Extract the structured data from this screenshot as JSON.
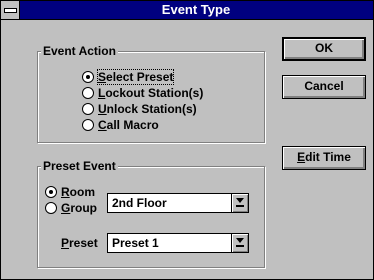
{
  "window": {
    "title": "Event Type"
  },
  "event_action": {
    "label": "Event Action",
    "options": [
      {
        "label": "Select Preset",
        "mn": "S",
        "rest": "elect Preset",
        "selected": true
      },
      {
        "label": "Lockout Station(s)",
        "mn": "L",
        "rest": "ockout Station(s)",
        "selected": false
      },
      {
        "label": "Unlock Station(s)",
        "mn": "U",
        "rest": "nlock Station(s)",
        "selected": false
      },
      {
        "label": "Call Macro",
        "mn": "C",
        "rest": "all Macro",
        "selected": false
      }
    ]
  },
  "preset_event": {
    "label": "Preset Event",
    "room": {
      "mn": "R",
      "rest": "oom",
      "selected": true
    },
    "group": {
      "mn": "G",
      "rest": "roup",
      "selected": false
    },
    "location_select": {
      "value": "2nd Floor"
    },
    "preset": {
      "mn": "P",
      "rest": "reset",
      "value": "Preset 1"
    }
  },
  "buttons": {
    "ok": "OK",
    "cancel": "Cancel",
    "edit_time": {
      "mn": "E",
      "rest": "dit Time"
    }
  }
}
